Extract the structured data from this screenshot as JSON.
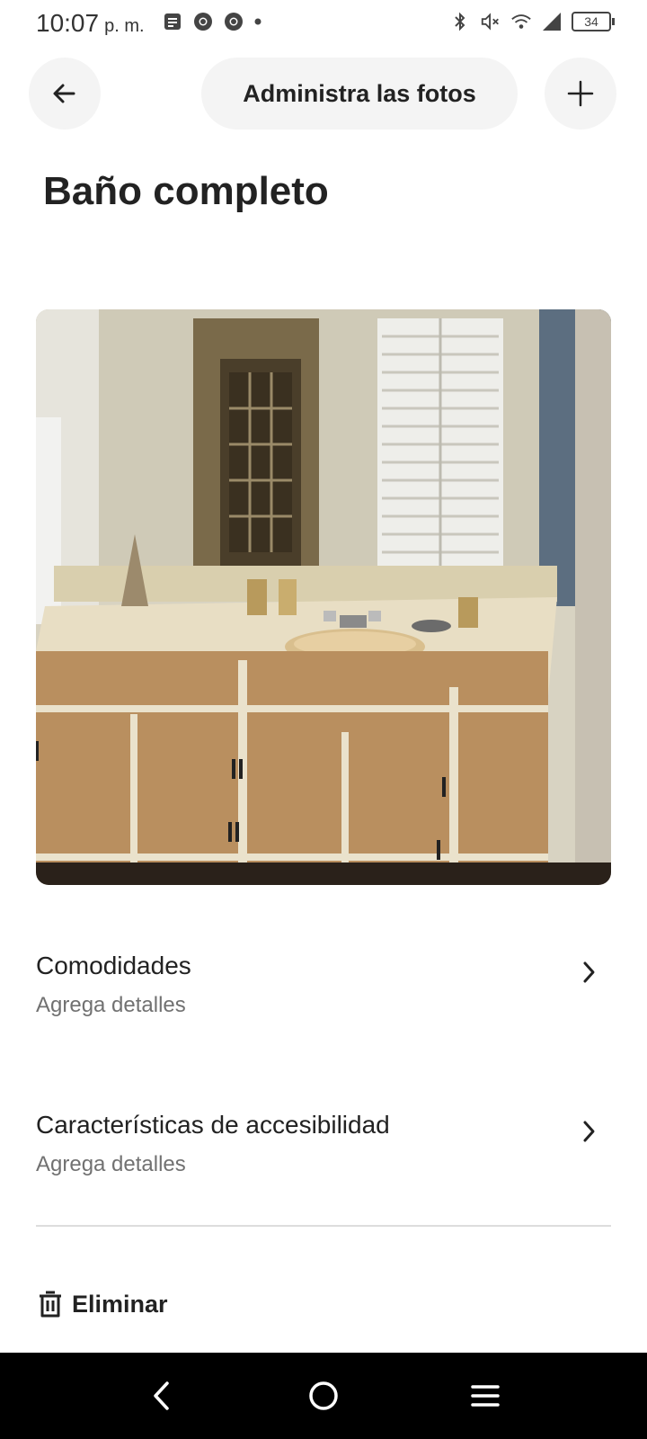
{
  "status_bar": {
    "time": "10:07",
    "ampm": "p. m.",
    "battery_level": "34",
    "left_icons": [
      "notes-icon",
      "chrome-icon",
      "chrome-icon",
      "dot-icon"
    ],
    "right_icons": [
      "bluetooth-icon",
      "mute-icon",
      "wifi-icon",
      "signal-icon",
      "battery-icon"
    ]
  },
  "header": {
    "title": "Administra las fotos",
    "back_icon": "arrow-left-icon",
    "add_icon": "plus-icon"
  },
  "room": {
    "title": "Baño completo",
    "photo_description_icon": "bathroom-photo"
  },
  "rows": [
    {
      "title": "Comodidades",
      "subtitle": "Agrega detalles"
    },
    {
      "title": "Características de accesibilidad",
      "subtitle": "Agrega detalles"
    }
  ],
  "delete": {
    "label": "Eliminar",
    "icon": "trash-icon"
  },
  "nav_bar": {
    "icons": [
      "back-icon",
      "home-icon",
      "recents-icon"
    ]
  },
  "colors": {
    "pill_bg": "#f4f4f4",
    "text_primary": "#222222",
    "text_secondary": "#717171",
    "divider": "#dddddd"
  }
}
